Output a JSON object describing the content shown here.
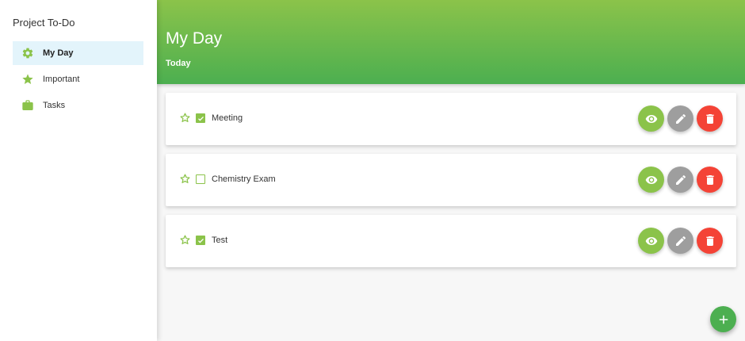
{
  "sidebar": {
    "title": "Project To-Do",
    "items": [
      {
        "label": "My Day",
        "icon": "gear-icon",
        "active": true
      },
      {
        "label": "Important",
        "icon": "star-icon",
        "active": false
      },
      {
        "label": "Tasks",
        "icon": "briefcase-icon",
        "active": false
      }
    ]
  },
  "header": {
    "title": "My Day",
    "subtitle": "Today"
  },
  "tasks": [
    {
      "label": "Meeting",
      "checked": true,
      "important": false
    },
    {
      "label": "Chemistry Exam",
      "checked": false,
      "important": false
    },
    {
      "label": "Test",
      "checked": true,
      "important": false
    }
  ],
  "actions": {
    "view_icon": "eye-icon",
    "edit_icon": "pencil-icon",
    "delete_icon": "trash-icon",
    "add_icon": "plus-icon"
  },
  "colors": {
    "accent_green": "#8bc34a",
    "header_gradient_top": "#8bc34a",
    "header_gradient_bottom": "#4caf50",
    "edit_gray": "#9e9e9e",
    "delete_red": "#f44336",
    "fab_green": "#4caf50",
    "active_nav_bg": "#e3f4fb"
  }
}
